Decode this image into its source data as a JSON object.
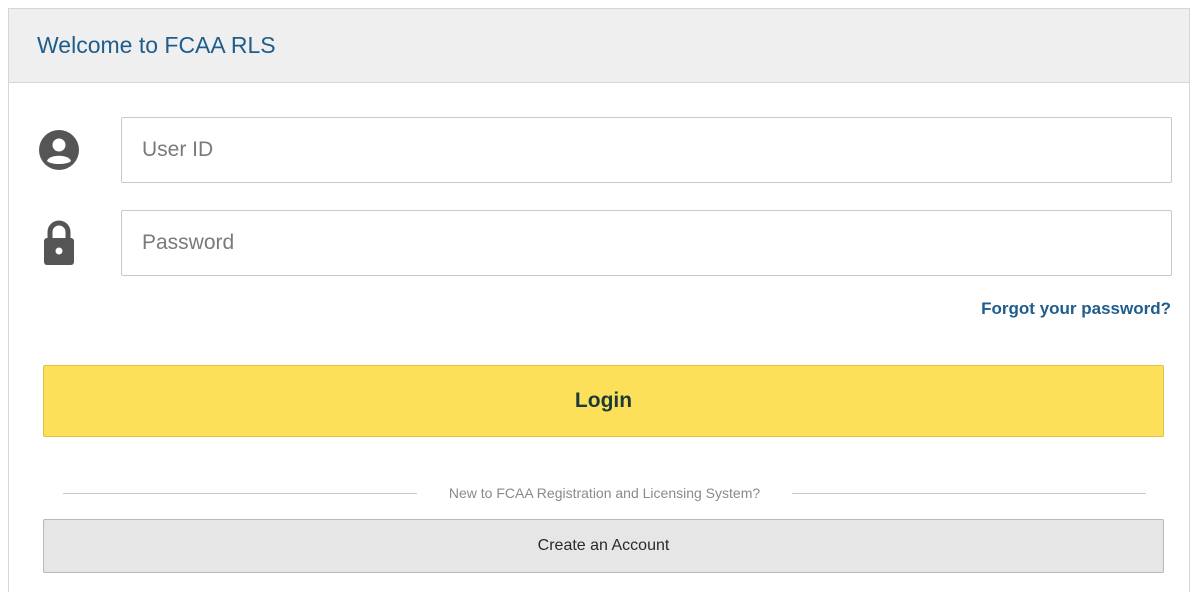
{
  "header": {
    "title": "Welcome to FCAA RLS"
  },
  "form": {
    "user_id": {
      "icon": "user-circle-icon",
      "placeholder": "User ID",
      "value": ""
    },
    "password": {
      "icon": "lock-icon",
      "placeholder": "Password",
      "value": ""
    },
    "forgot_label": "Forgot your password?",
    "login_label": "Login",
    "divider_text": "New to FCAA Registration and Licensing System?",
    "create_account_label": "Create an Account"
  },
  "colors": {
    "title": "#1f5d8c",
    "link": "#1f5d8c",
    "login_bg": "#fde05a",
    "create_bg": "#e6e6e6",
    "icon": "#555555"
  }
}
